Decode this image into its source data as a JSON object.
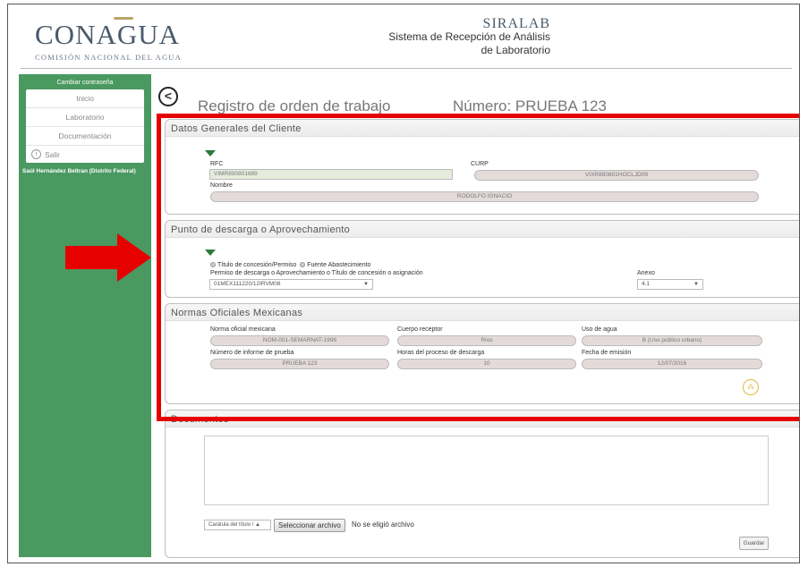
{
  "header": {
    "logo_main": "CONAGUA",
    "logo_sub": "COMISIÓN NACIONAL DEL AGUA",
    "brand": "SIRALAB",
    "subtitle_line1": "Sistema de Recepción de Análisis",
    "subtitle_line2": "de Laboratorio"
  },
  "sidebar": {
    "change_password": "Cambiar contraseña",
    "items": [
      {
        "label": "Inicio"
      },
      {
        "label": "Laboratorio"
      },
      {
        "label": "Documentación"
      }
    ],
    "logout": "Salir",
    "user": "Saúl Hernández Beltran (Distrito Federal)"
  },
  "page": {
    "title": "Registro de orden de trabajo",
    "number": "Número: PRUEBA 123"
  },
  "client": {
    "heading": "Datos Generales del Cliente",
    "rfc_label": "RFC",
    "rfc_value": "VIMR890801689",
    "curp_label": "CURP",
    "curp_value": "VIXR890801HOCLJD09",
    "name_label": "Nombre",
    "name_value": "RODOLFO IGNACIO"
  },
  "discharge": {
    "heading": "Punto de descarga o Aprovechamiento",
    "radio1": "Título de concesión/Permiso",
    "radio2": "Fuente Abastecimiento",
    "permit_label": "Permiso de descarga o Aprovechamiento o Título de concesión o asignación",
    "permit_value": "01MEX111220/12IRVM08",
    "annex_label": "Anexo",
    "annex_value": "4.1"
  },
  "norms": {
    "heading": "Normas Oficiales Mexicanas",
    "norm_label": "Norma oficial mexicana",
    "norm_value": "NOM-001-SEMARNAT-1996",
    "body_label": "Cuerpo receptor",
    "body_value": "Ríos",
    "use_label": "Uso de agua",
    "use_value": "B (Uso público urbano)",
    "report_label": "Número de informe de prueba",
    "report_value": "PRUEBA 123",
    "hours_label": "Horas del proceso de descarga",
    "hours_value": "10",
    "date_label": "Fecha de emisión",
    "date_value": "12/07/2016"
  },
  "documents": {
    "heading": "Documentos",
    "doc_type": "Carátula del título / ▲",
    "file_button": "Seleccionar archivo",
    "file_status": "No se eligió archivo",
    "save": "Guardar"
  },
  "colors": {
    "sidebar": "#4a9960",
    "highlight": "#e60000",
    "accent_triangle": "#2a7a3a"
  }
}
